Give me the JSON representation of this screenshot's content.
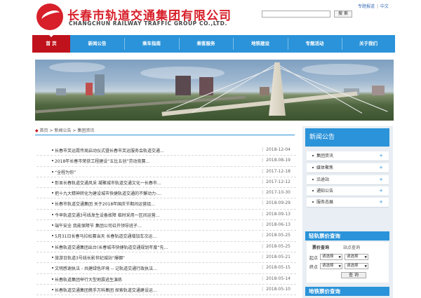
{
  "header": {
    "logo_cn": "长春市轨道交通集团有限公司",
    "logo_en": "CHANGCHUN RAILWAY TRAFFIC GROUP CO.,LTD.",
    "toplinks": [
      "专题报道",
      "中文"
    ],
    "search_placeholder": "",
    "search_button": "搜 索"
  },
  "nav": {
    "items": [
      "首 页",
      "新闻公告",
      "乘车指南",
      "乘客服务",
      "地铁建设",
      "专题活动",
      "关于我们"
    ],
    "active_color": "#c0121c",
    "bar_color": "#2b93d9"
  },
  "breadcrumb": [
    "首页",
    "新闻公告",
    "集团资讯"
  ],
  "articles": [
    {
      "title": "长春市芙运霞传周启动仪式暨长春市芙运服务会轨道交通…",
      "date": "2018-12-04"
    },
    {
      "title": "2018年长春市荣获工程建设“五比五创”劳动竞赛…",
      "date": "2018-08-19"
    },
    {
      "title": "“全程为你”",
      "date": "2017-12-18"
    },
    {
      "title": "彰显长春轨道交通风采 凝聚城市轨道交通文化一长春市…",
      "date": "2017-12-12"
    },
    {
      "title": "把十九大精神转化为建设城市快捷轨道交通的不懈动力-…",
      "date": "2017-10-30"
    },
    {
      "title": "长春市轨道交通集团 关于2018年国庆节期间运营组…",
      "date": "2018-09-29"
    },
    {
      "title": "今早轨道交通3号线发生设备故障 临时采用一区间运营…",
      "date": "2018-09-13"
    },
    {
      "title": "端午安全 我能保障节 集团公司召开领导班子…",
      "date": "2018-06-13"
    },
    {
      "title": "5月31日长春马拉松赛当天 长春轨道交通增加车次运…",
      "date": "2018-05-25"
    },
    {
      "title": "长春轨道交通集团出台(长春城市快捷轨道交通规划年度“先…",
      "date": "2018-05-25"
    },
    {
      "title": "旅游日轨道3号线长影世纪城站“爆棚”",
      "date": "2018-05-21"
    },
    {
      "title": "文明感谢执法 - 共建绿色环境 -- 记轨道交通行政执法…",
      "date": "2018-05-15"
    },
    {
      "title": "长春轨道集团举行大型地震逃生演练",
      "date": "2018-05-14"
    },
    {
      "title": "长春轨道交通集团携手万科集团 探索轨道交通建设运…",
      "date": "2018-05-10"
    }
  ],
  "sidebar": {
    "news_title": "新闻公告",
    "items": [
      "集团资讯",
      "媒体聚焦",
      "沿途站",
      "通知公告",
      "服务态展"
    ],
    "fare_title": "轻轨票价查询",
    "fare_tabs": [
      "票价查询",
      "站点查询"
    ],
    "start_label": "起点",
    "end_label": "终点",
    "select_placeholder": "请选择",
    "query_button": "查 询",
    "metro_title": "地铁票价查询"
  }
}
